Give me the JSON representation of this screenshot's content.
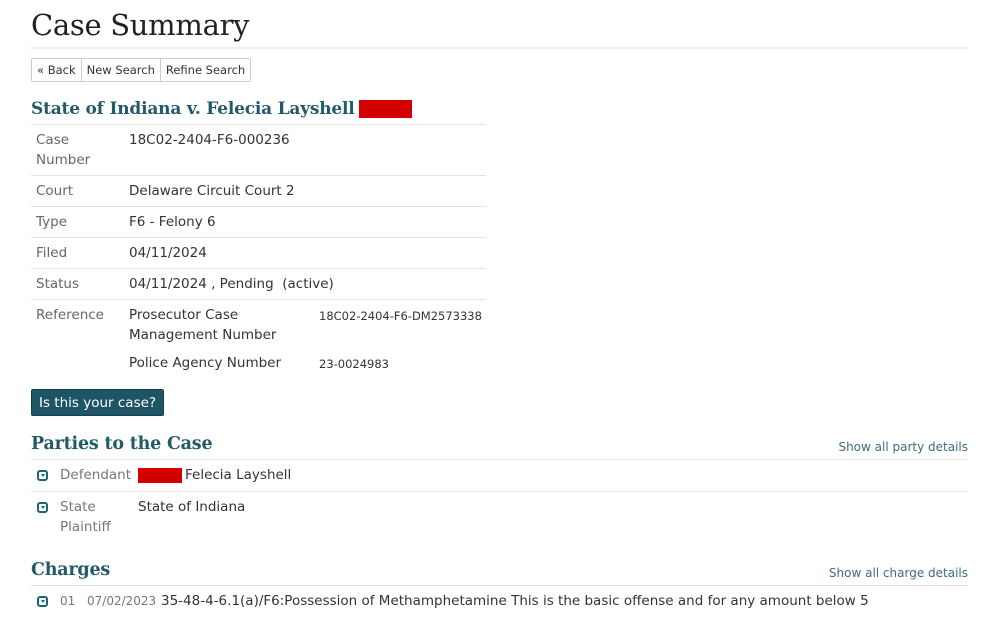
{
  "page": {
    "title": "Case Summary"
  },
  "nav_buttons": {
    "back": "« Back",
    "new_search": "New Search",
    "refine_search": "Refine Search"
  },
  "case": {
    "heading": "State of Indiana v. Felecia Layshell",
    "heading_redacted": true,
    "fields": {
      "case_number": {
        "label": "Case Number",
        "value": "18C02-2404-F6-000236"
      },
      "court": {
        "label": "Court",
        "value": "Delaware Circuit Court 2"
      },
      "type": {
        "label": "Type",
        "value": "F6 - Felony 6"
      },
      "filed": {
        "label": "Filed",
        "value": "04/11/2024"
      },
      "status": {
        "label": "Status",
        "value": "04/11/2024 , Pending  (active)"
      },
      "reference": {
        "label": "Reference",
        "items": [
          {
            "label": "Prosecutor Case Management Number",
            "value": "18C02-2404-F6-DM2573338"
          },
          {
            "label": "Police Agency Number",
            "value": "23-0024983"
          }
        ]
      }
    },
    "your_case_button": "Is this your case?"
  },
  "parties": {
    "heading": "Parties to the Case",
    "show_all_link": "Show all party details",
    "rows": [
      {
        "role": "Defendant",
        "name": "Felecia Layshell",
        "redacted_prefix": true,
        "icon": "expand-icon"
      },
      {
        "role": "State Plaintiff",
        "name": "State of Indiana",
        "redacted_prefix": false,
        "icon": "expand-icon"
      }
    ]
  },
  "charges": {
    "heading": "Charges",
    "show_all_link": "Show all charge details",
    "rows": [
      {
        "number": "01",
        "date": "07/02/2023",
        "description": "35-48-4-6.1(a)/F6:Possession of Methamphetamine This is the basic offense and for any amount below 5",
        "icon": "expand-icon"
      }
    ]
  },
  "colors": {
    "heading_teal": "#235a6a",
    "button_bg": "#1d5566",
    "redaction": "#d40000",
    "link": "#3d6d7c"
  }
}
